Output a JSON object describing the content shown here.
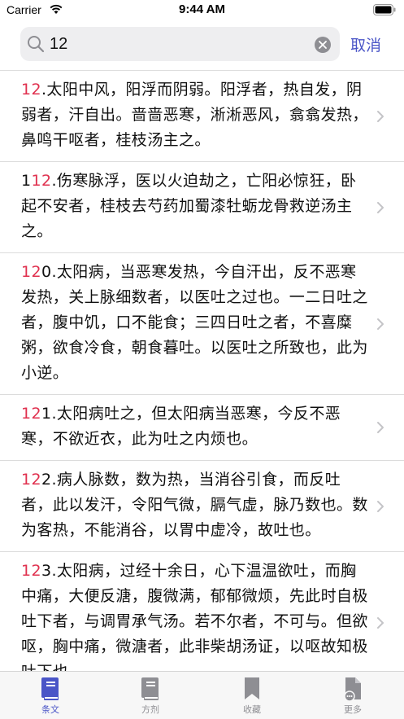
{
  "status_bar": {
    "carrier": "Carrier",
    "time": "9:44 AM"
  },
  "search": {
    "value": "12",
    "cancel_label": "取消"
  },
  "results": [
    {
      "prefix": "",
      "match": "12",
      "rest": ".太阳中风，阳浮而阴弱。阳浮者，热自发，阴弱者，汗自出。啬啬恶寒，淅淅恶风，翕翕发热，鼻鸣干呕者，桂枝汤主之。"
    },
    {
      "prefix": "1",
      "match": "12",
      "rest": ".伤寒脉浮，医以火迫劫之，亡阳必惊狂，卧起不安者，桂枝去芍药加蜀漆牡蛎龙骨救逆汤主之。"
    },
    {
      "prefix": "",
      "match": "12",
      "rest": "0.太阳病，当恶寒发热，今自汗出，反不恶寒发热，关上脉细数者，以医吐之过也。一二日吐之者，腹中饥，口不能食；三四日吐之者，不喜糜粥，欲食冷食，朝食暮吐。以医吐之所致也，此为小逆。"
    },
    {
      "prefix": "",
      "match": "12",
      "rest": "1.太阳病吐之，但太阳病当恶寒，今反不恶寒，不欲近衣，此为吐之内烦也。"
    },
    {
      "prefix": "",
      "match": "12",
      "rest": "2.病人脉数，数为热，当消谷引食，而反吐者，此以发汗，令阳气微，膈气虚，脉乃数也。数为客热，不能消谷，以胃中虚冷，故吐也。"
    },
    {
      "prefix": "",
      "match": "12",
      "rest": "3.太阳病，过经十余日，心下温温欲吐，而胸中痛，大便反溏，腹微满，郁郁微烦，先此时自极吐下者，与调胃承气汤。若不尔者，不可与。但欲呕，胸中痛，微溏者，此非柴胡汤证，以呕故知极吐下也。"
    }
  ],
  "tab_bar": {
    "tabs": [
      {
        "label": "条文",
        "icon": "book-icon",
        "active": true
      },
      {
        "label": "方剂",
        "icon": "book-outline-icon",
        "active": false
      },
      {
        "label": "收藏",
        "icon": "bookmark-icon",
        "active": false
      },
      {
        "label": "更多",
        "icon": "document-more-icon",
        "active": false
      }
    ]
  },
  "colors": {
    "accent": "#4a55c7",
    "highlight": "#e0314f",
    "inactive": "#8e8e93"
  }
}
